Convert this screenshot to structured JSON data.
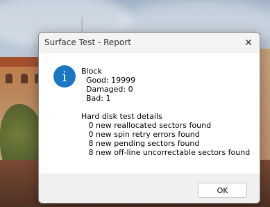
{
  "dialog": {
    "title": "Surface Test - Report",
    "close_glyph": "✕",
    "icon": "info-icon",
    "icon_glyph": "i",
    "lines": [
      "Block",
      "  Good: 19999",
      "  Damaged: 0",
      "  Bad: 1",
      "",
      "Hard disk test details",
      "   0 new reallocated sectors found",
      "   0 new spin retry errors found",
      "   8 new pending sectors found",
      "   8 new off-line uncorrectable sectors found"
    ],
    "ok_label": "OK"
  },
  "colors": {
    "accent": "#1a78c2",
    "titlebar": "#f3f3f3",
    "footer": "#f0f0f0"
  }
}
